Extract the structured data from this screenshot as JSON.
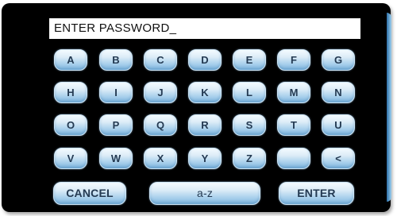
{
  "display": {
    "text": "ENTER PASSWORD_"
  },
  "keys": {
    "row1": [
      "A",
      "B",
      "C",
      "D",
      "E",
      "F",
      "G"
    ],
    "row2": [
      "H",
      "I",
      "J",
      "K",
      "L",
      "M",
      "N"
    ],
    "row3": [
      "O",
      "P",
      "Q",
      "R",
      "S",
      "T",
      "U"
    ],
    "row4": [
      "V",
      "W",
      "X",
      "Y",
      "Z",
      "",
      "<"
    ]
  },
  "actions": {
    "cancel": "CANCEL",
    "case": "a-z",
    "enter": "ENTER"
  }
}
